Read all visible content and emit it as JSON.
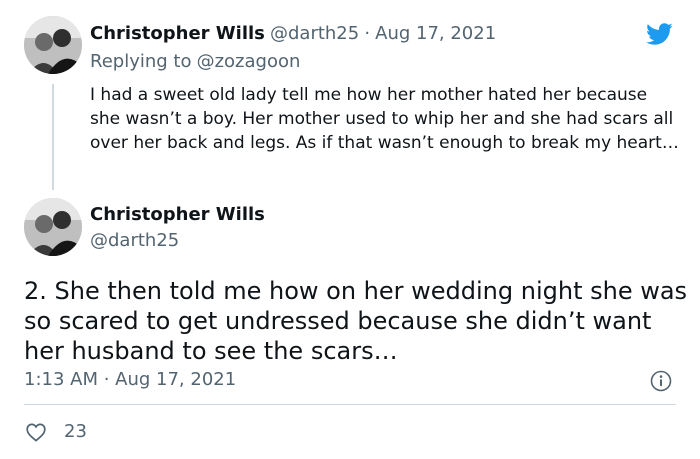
{
  "reply_tweet": {
    "author_name": "Christopher Wills",
    "handle": "@darth25",
    "separator": "·",
    "date": "Aug 17, 2021",
    "replying_prefix": "Replying to",
    "replying_to": "@zozagoon",
    "text": "I had a sweet old lady tell me how her mother hated her because she wasn’t a boy. Her mother used to whip her and she had scars all over her back and legs. As if that wasn’t enough to break my heart…"
  },
  "main_tweet": {
    "author_name": "Christopher Wills",
    "handle": "@darth25",
    "text": "2. She then told me how on her wedding night she was so scared to get undressed because she didn’t want her husband to see the scars…",
    "timestamp": "1:13 AM · Aug 17, 2021",
    "likes": "23"
  },
  "icons": {
    "brand": "twitter-bird-icon",
    "info": "info-icon",
    "like": "heart-icon"
  },
  "colors": {
    "twitter_blue": "#1d9bf0",
    "text": "#0f1419",
    "muted": "#536471",
    "border": "#cfd9de"
  }
}
